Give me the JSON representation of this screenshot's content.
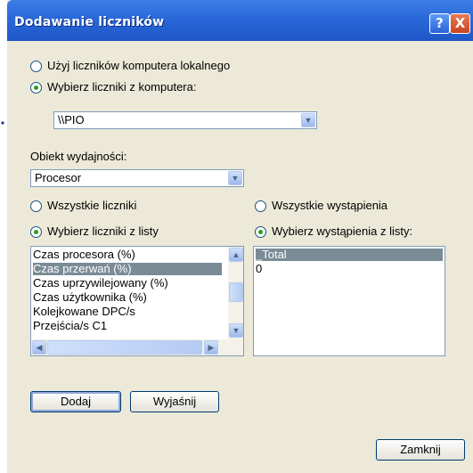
{
  "window": {
    "title": "Dodawanie liczników",
    "help_icon": "?",
    "close_icon": "X"
  },
  "source": {
    "local_label": "Użyj liczników komputera lokalnego",
    "local_selected": false,
    "remote_label": "Wybierz liczniki z komputera:",
    "remote_selected": true,
    "computer_value": "\\\\PIO"
  },
  "object": {
    "label": "Obiekt wydajności:",
    "value": "Procesor"
  },
  "counters": {
    "all_label": "Wszystkie liczniki",
    "all_selected": false,
    "list_label": "Wybierz liczniki z listy",
    "list_selected": true,
    "items": [
      "Czas procesora (%)",
      "Czas przerwań (%)",
      "Czas uprzywilejowany (%)",
      "Czas użytkownika (%)",
      "Kolejkowane DPC/s",
      "Przejścia/s C1"
    ],
    "selected_index": 1
  },
  "instances": {
    "all_label": "Wszystkie wystąpienia",
    "all_selected": false,
    "list_label": "Wybierz wystąpienia z listy:",
    "list_selected": true,
    "items": [
      "_Total",
      "0"
    ],
    "selected_index": 0
  },
  "buttons": {
    "add": "Dodaj",
    "explain": "Wyjaśnij",
    "close": "Zamknij"
  },
  "colors": {
    "title_bar": "#2a68d9",
    "window_bg": "#ece9d8",
    "selection": "#7a8b96",
    "radio_dot": "#21a121"
  }
}
